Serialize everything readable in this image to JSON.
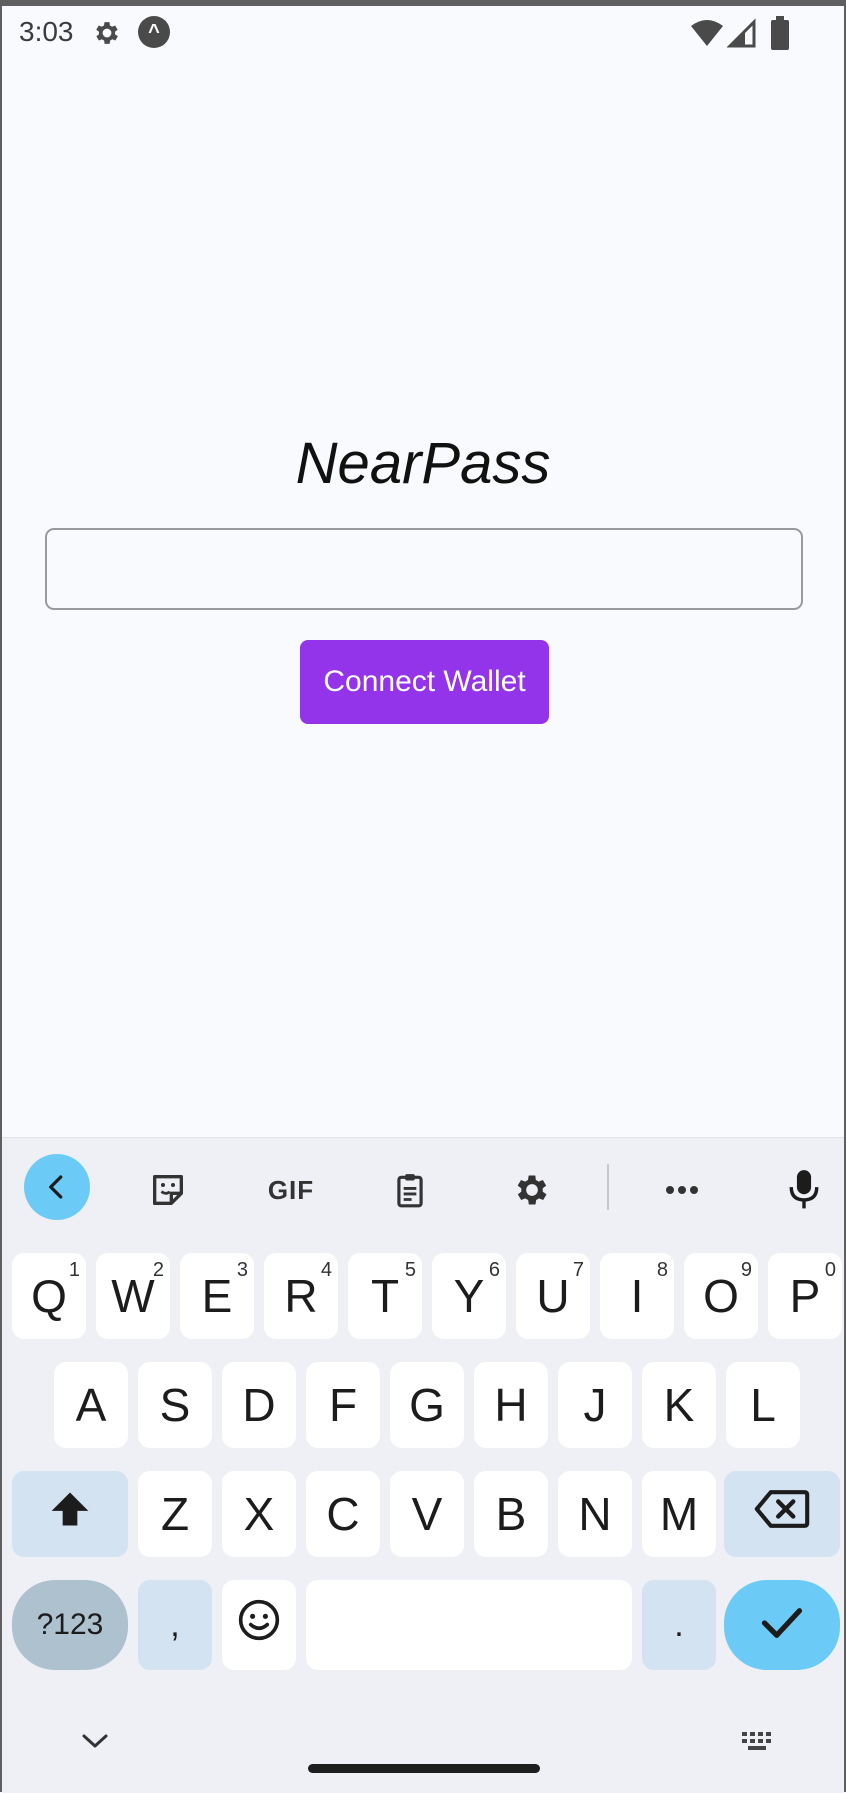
{
  "status_bar": {
    "time": "3:03",
    "icons": [
      "settings-icon",
      "app-notification-icon",
      "wifi-icon",
      "signal-icon",
      "battery-icon"
    ],
    "app_glyph": "^"
  },
  "app": {
    "title": "NearPass",
    "input": {
      "value": "",
      "placeholder": ""
    },
    "connect_button": "Connect Wallet",
    "accent_color": "#9333ea"
  },
  "keyboard": {
    "toolbar": {
      "gif_label": "GIF",
      "items": [
        "back-icon",
        "sticker-icon",
        "gif-button",
        "clipboard-icon",
        "settings-icon",
        "more-icon",
        "mic-icon"
      ]
    },
    "row1": [
      {
        "label": "Q",
        "sup": "1"
      },
      {
        "label": "W",
        "sup": "2"
      },
      {
        "label": "E",
        "sup": "3"
      },
      {
        "label": "R",
        "sup": "4"
      },
      {
        "label": "T",
        "sup": "5"
      },
      {
        "label": "Y",
        "sup": "6"
      },
      {
        "label": "U",
        "sup": "7"
      },
      {
        "label": "I",
        "sup": "8"
      },
      {
        "label": "O",
        "sup": "9"
      },
      {
        "label": "P",
        "sup": "0"
      }
    ],
    "row2": [
      "A",
      "S",
      "D",
      "F",
      "G",
      "H",
      "J",
      "K",
      "L"
    ],
    "row3": [
      "Z",
      "X",
      "C",
      "V",
      "B",
      "N",
      "M"
    ],
    "row4": {
      "symbols": "?123",
      "comma": ",",
      "period": "."
    },
    "key_colors": {
      "modifier": "#d3e3f2",
      "enter": "#6ccbf6",
      "symbols": "#adc1cf"
    }
  }
}
